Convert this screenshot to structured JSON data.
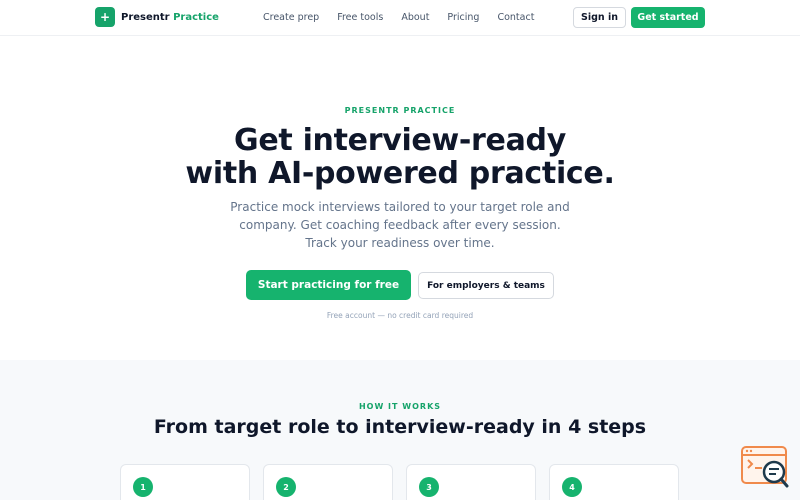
{
  "nav": {
    "brand_primary": "Presentr",
    "brand_accent": "Practice",
    "logo_icon": "plus-icon",
    "links": [
      "Create prep",
      "Free tools",
      "About",
      "Pricing",
      "Contact"
    ],
    "signin_label": "Sign in",
    "getstarted_label": "Get started"
  },
  "hero": {
    "eyebrow": "PRESENTR PRACTICE",
    "title_line1": "Get interview-ready",
    "title_line2": "with AI-powered practice.",
    "sub_line1": "Practice mock interviews tailored to your target role and",
    "sub_line2": "company. Get coaching feedback after every session.",
    "sub_line3": "Track your readiness over time.",
    "primary_cta": "Start practicing for free",
    "secondary_cta": "For employers & teams",
    "fineprint": "Free account — no credit card required"
  },
  "how": {
    "eyebrow": "HOW IT WORKS",
    "title": "From target role to interview-ready in 4 steps",
    "steps": [
      "1",
      "2",
      "3",
      "4"
    ]
  },
  "widget": {
    "icon": "search-chat-icon"
  },
  "colors": {
    "accent": "#16b36e",
    "text": "#0f172a",
    "muted": "#64748b",
    "widget": "#f08a4b"
  }
}
